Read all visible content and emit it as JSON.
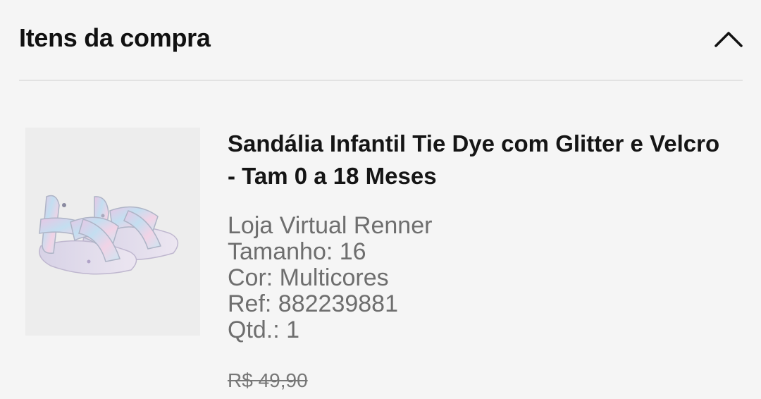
{
  "section": {
    "title": "Itens da compra",
    "toggle_icon": "chevron-up-icon"
  },
  "item": {
    "image_alt": "product-sandal-image",
    "name": "Sandália Infantil Tie Dye com Glitter e Velcro - Tam 0 a 18 Meses",
    "seller": "Loja Virtual Renner",
    "size": "Tamanho: 16",
    "color": "Cor: Multicores",
    "ref": "Ref: 882239881",
    "qty": "Qtd.: 1",
    "old_price": "R$ 49,90"
  },
  "colors": {
    "background": "#f5f5f5",
    "text": "#111111",
    "secondary_text": "#6e6e6e",
    "divider": "#e2e2e2"
  }
}
